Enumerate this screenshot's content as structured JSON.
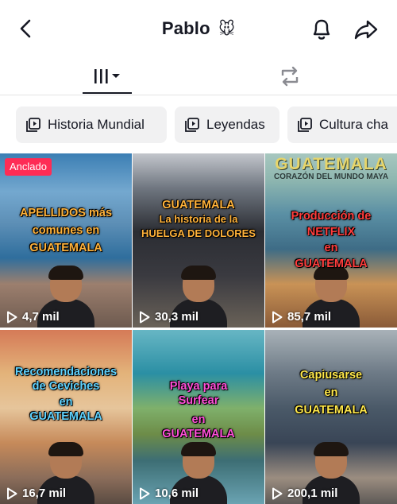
{
  "header": {
    "title": "Pablo",
    "title_emoji": "🐭",
    "back_icon": "chevron-left-icon",
    "bell_icon": "bell-icon",
    "share_icon": "share-arrow-icon"
  },
  "tabs": {
    "videos_icon": "grid-columns-icon",
    "reposts_icon": "repost-icon"
  },
  "playlists": [
    {
      "label": "Historia Mundial"
    },
    {
      "label": "Leyendas"
    },
    {
      "label": "Cultura cha"
    }
  ],
  "videos": [
    {
      "pinned_label": "Anclado",
      "overlay": [
        "APELLIDOS más",
        "comunes en",
        "GUATEMALA"
      ],
      "views": "4,7 mil"
    },
    {
      "overlay": [
        "GUATEMALA",
        "La historia de la",
        "HUELGA DE DOLORES"
      ],
      "views": "30,3 mil"
    },
    {
      "banner": "GUATEMALA",
      "banner_sub": "CORAZÓN DEL MUNDO MAYA",
      "overlay": [
        "Producción de",
        "NETFLIX",
        "en",
        "GUATEMALA"
      ],
      "views": "85,7 mil"
    },
    {
      "overlay": [
        "Recomendaciones",
        "de Ceviches",
        "en",
        "GUATEMALA"
      ],
      "views": "16,7 mil"
    },
    {
      "overlay": [
        "Playa para",
        "Surfear",
        "en",
        "GUATEMALA"
      ],
      "views": "10,6 mil"
    },
    {
      "overlay": [
        "Capiusarse",
        "en",
        "GUATEMALA"
      ],
      "views": "200,1 mil"
    }
  ]
}
